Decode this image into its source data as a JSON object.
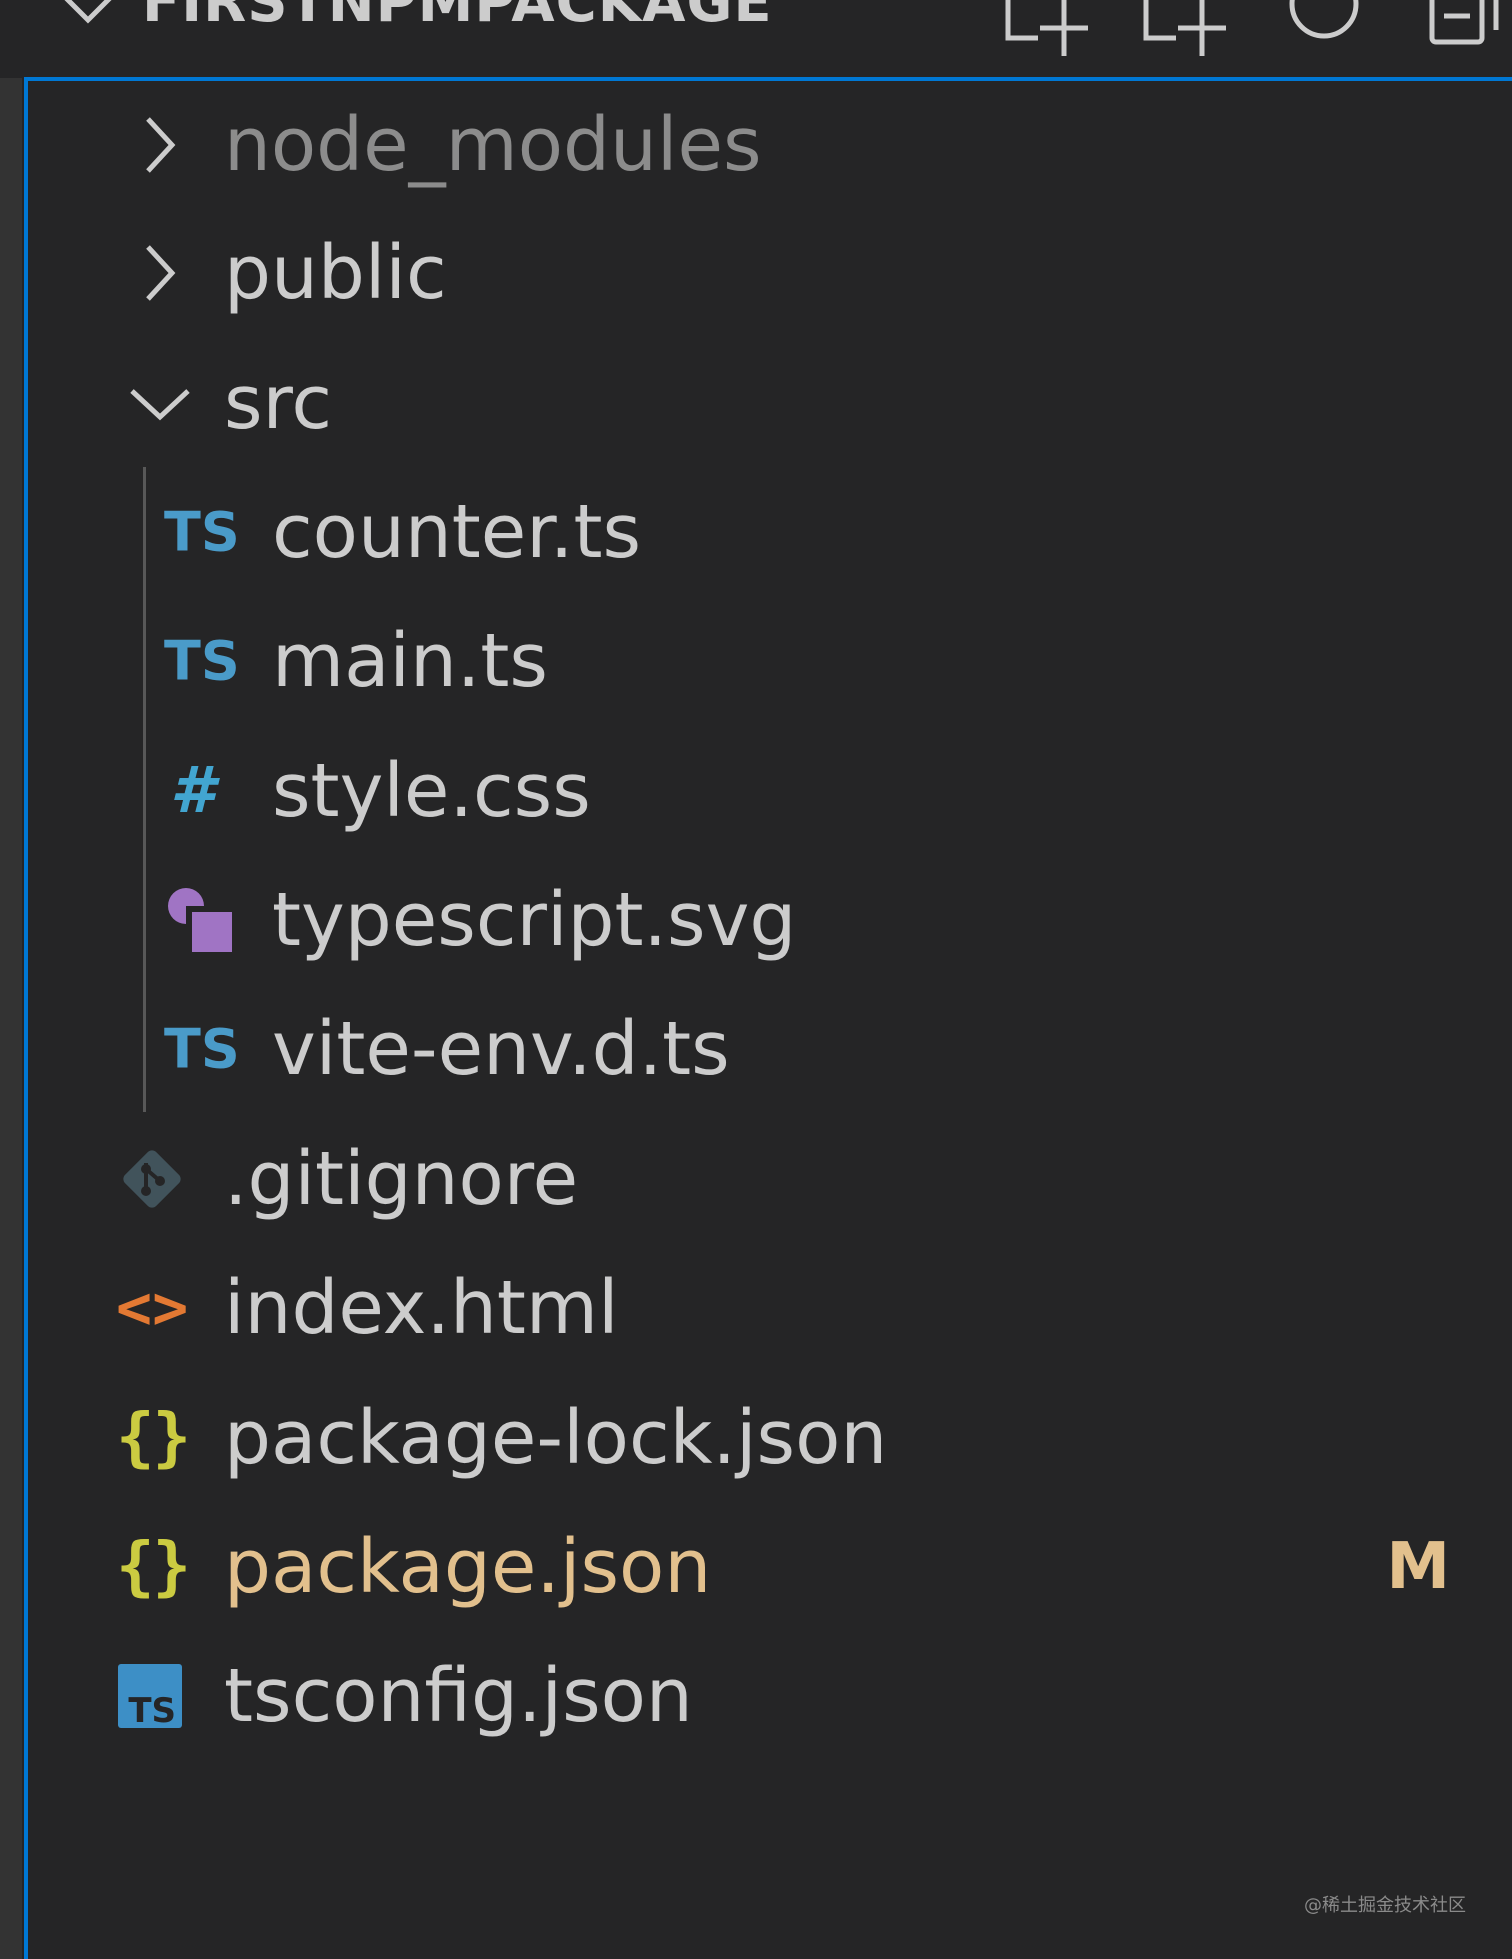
{
  "header": {
    "title": "FIRSTNPMPACKAGE",
    "buttons": [
      "new-file-icon",
      "new-folder-icon",
      "refresh-icon",
      "collapse-all-icon"
    ]
  },
  "tree": {
    "node_modules": "node_modules",
    "public": "public",
    "src": "src",
    "counter": "counter.ts",
    "main": "main.ts",
    "style": "style.css",
    "typescript_svg": "typescript.svg",
    "vite_env": "vite-env.d.ts",
    "gitignore": ".gitignore",
    "index_html": "index.html",
    "package_lock": "package-lock.json",
    "package_json": "package.json",
    "tsconfig": "tsconfig.json"
  },
  "icons": {
    "ts_label": "TS",
    "ts_small": "TS",
    "hash": "#",
    "braces": "{}",
    "html": "<>"
  },
  "badges": {
    "package_json": "M"
  },
  "colors": {
    "background": "#252526",
    "focus_border": "#0078d4",
    "text": "#cccccc",
    "ignored_text": "#8c8c8c",
    "modified_text": "#e2c08d",
    "ts_blue": "#4a9bc9",
    "json_yellow": "#cbcb41",
    "html_orange": "#e37933",
    "svg_purple": "#a074c4"
  },
  "watermark": "@稀土掘金技术社区"
}
